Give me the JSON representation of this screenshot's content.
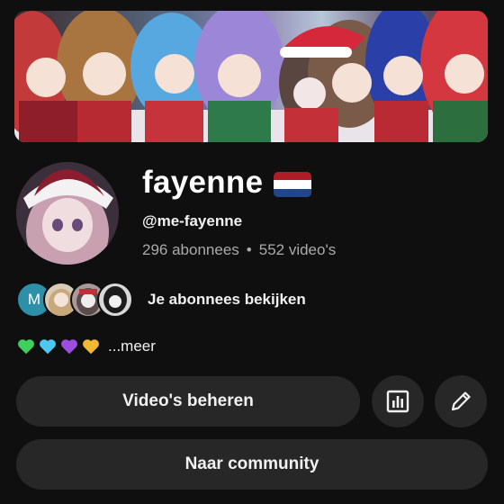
{
  "channel": {
    "name": "fayenne",
    "flag_icon": "netherlands-flag-icon",
    "flag_colors": [
      "#ae1c28",
      "#ffffff",
      "#21468b"
    ],
    "handle": "@me-fayenne",
    "subscribers": "296 abonnees",
    "separator": "•",
    "videos": "552 video's"
  },
  "subscriptions": {
    "first_avatar_letter": "M",
    "label": "Je abonnees bekijken"
  },
  "description": {
    "hearts": [
      "green-heart-icon",
      "blue-heart-icon",
      "purple-heart-icon",
      "yellow-heart-icon"
    ],
    "heart_colors": [
      "#3ecf5c",
      "#4cc8f0",
      "#9b4ee0",
      "#f2b830"
    ],
    "more_label": "...meer"
  },
  "actions": {
    "manage_videos": "Video's beheren",
    "community": "Naar community"
  },
  "colors": {
    "background": "#0f0f0f",
    "button": "#272727",
    "secondary_text": "#aaaaaa"
  }
}
